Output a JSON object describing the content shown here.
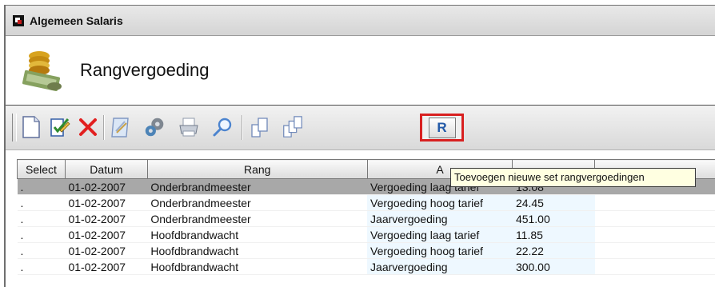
{
  "window": {
    "title": "Algemeen Salaris"
  },
  "header": {
    "title": "Rangvergoeding"
  },
  "toolbar": {
    "buttons": [
      {
        "name": "new-document-icon"
      },
      {
        "name": "edit-check-icon"
      },
      {
        "name": "delete-x-icon"
      },
      {
        "name": "notepad-icon"
      },
      {
        "name": "settings-gears-icon"
      },
      {
        "name": "printer-icon"
      },
      {
        "name": "search-magnifier-icon"
      },
      {
        "name": "copy-icon"
      },
      {
        "name": "copy-multiple-icon"
      }
    ],
    "r_button_label": "R",
    "tooltip": "Toevoegen nieuwe set rangvergoedingen"
  },
  "grid": {
    "columns": [
      "Select",
      "Datum",
      "Rang",
      "A",
      "",
      ""
    ],
    "rows": [
      {
        "select": ".",
        "datum": "01-02-2007",
        "rang": "Onderbrandmeester",
        "type": "Vergoeding laag tarief",
        "bedrag": "13.08",
        "selected": true
      },
      {
        "select": ".",
        "datum": "01-02-2007",
        "rang": "Onderbrandmeester",
        "type": "Vergoeding hoog tarief",
        "bedrag": "24.45",
        "selected": false
      },
      {
        "select": ".",
        "datum": "01-02-2007",
        "rang": "Onderbrandmeester",
        "type": "Jaarvergoeding",
        "bedrag": "451.00",
        "selected": false
      },
      {
        "select": ".",
        "datum": "01-02-2007",
        "rang": "Hoofdbrandwacht",
        "type": "Vergoeding laag tarief",
        "bedrag": "11.85",
        "selected": false
      },
      {
        "select": ".",
        "datum": "01-02-2007",
        "rang": "Hoofdbrandwacht",
        "type": "Vergoeding hoog tarief",
        "bedrag": "22.22",
        "selected": false
      },
      {
        "select": ".",
        "datum": "01-02-2007",
        "rang": "Hoofdbrandwacht",
        "type": "Jaarvergoeding",
        "bedrag": "300.00",
        "selected": false
      }
    ]
  },
  "colors": {
    "highlight": "#d82020",
    "selected_row": "#a8a8a8",
    "tooltip_bg": "#ffffe1"
  }
}
